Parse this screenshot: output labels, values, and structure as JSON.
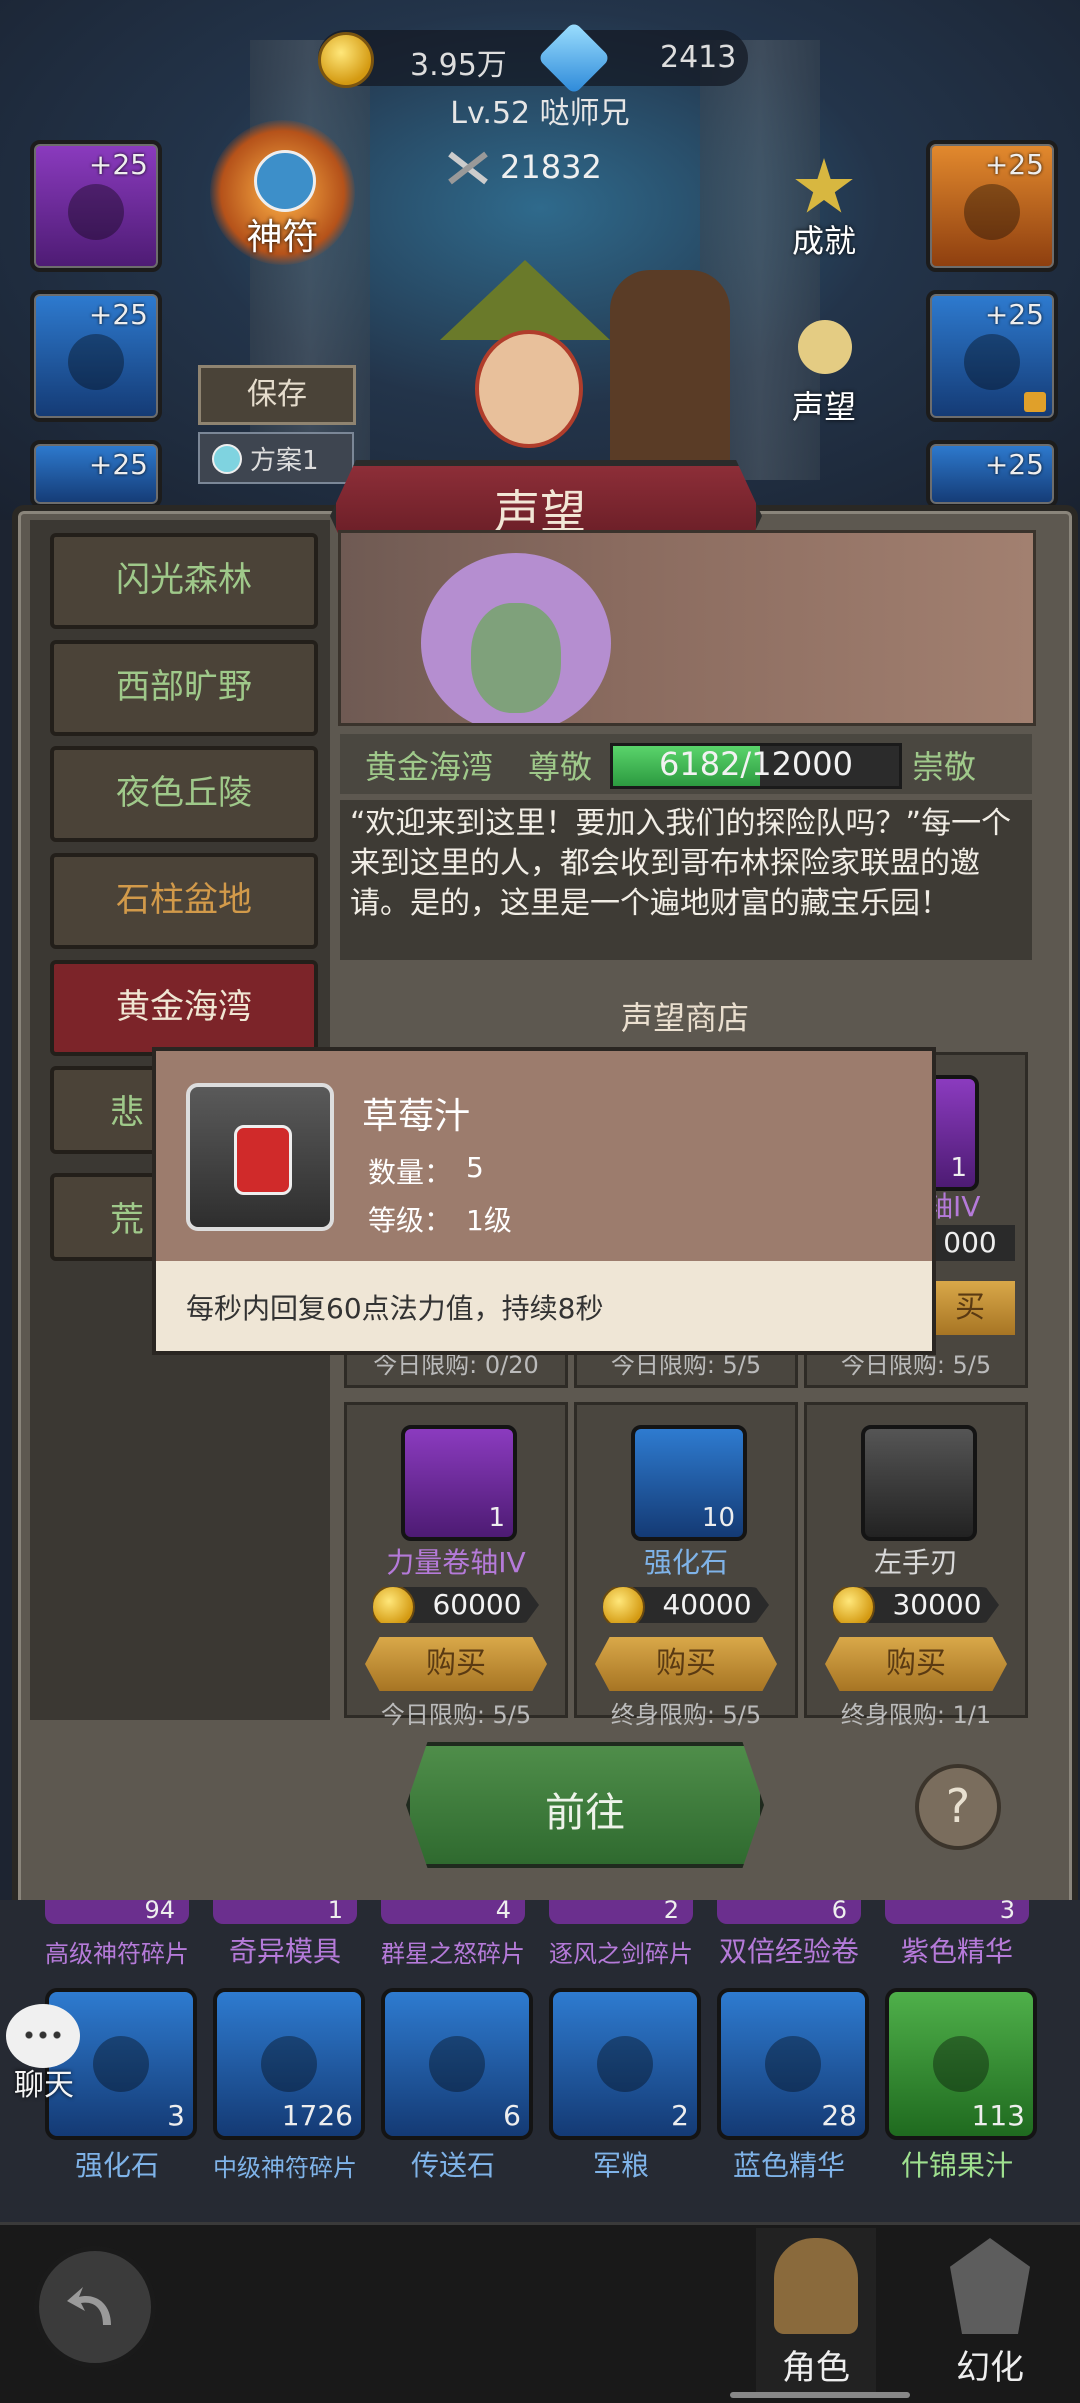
{
  "currency": {
    "gold": "3.95万",
    "gems": "2413"
  },
  "player": {
    "level_name": "Lv.52 哒师兄",
    "power": "21832"
  },
  "buttons": {
    "rune": "神符",
    "achievement": "成就",
    "reputation": "声望",
    "save": "保存",
    "plan1": "方案1"
  },
  "side_slots": {
    "plus": "+25"
  },
  "panel": {
    "title": "声望"
  },
  "regions": [
    "闪光森林",
    "西部旷野",
    "夜色丘陵",
    "石柱盆地",
    "黄金海湾",
    "悲",
    "荒"
  ],
  "faction": {
    "name": "黄金海湾",
    "current_rank": "尊敬",
    "progress_text": "6182/12000",
    "progress": 0.515,
    "next_rank": "崇敬",
    "description": "“欢迎来到这里！要加入我们的探险队吗？”每一个来到这里的人，都会收到哥布林探险家联盟的邀请。是的，这里是一个遍地财富的藏宝乐园！"
  },
  "shop": {
    "title": "声望商店",
    "top_row_partial": {
      "name_tail": "轴IV",
      "price_tail": "000",
      "count": "1",
      "buy_tail": "买"
    },
    "top_limits": [
      "今日限购: 0/20",
      "今日限购: 5/5",
      "今日限购: 5/5"
    ],
    "items": [
      {
        "name": "力量卷轴IV",
        "count": "1",
        "price": "60000",
        "buy": "购买",
        "limit": "今日限购: 5/5"
      },
      {
        "name": "强化石",
        "count": "10",
        "price": "40000",
        "buy": "购买",
        "limit": "终身限购: 5/5"
      },
      {
        "name": "左手刃",
        "count": "",
        "price": "30000",
        "buy": "购买",
        "limit": "终身限购: 1/1"
      }
    ]
  },
  "tooltip": {
    "name": "草莓汁",
    "qty_label": "数量：",
    "qty": "5",
    "level_label": "等级：",
    "level": "1级",
    "effect": "每秒内回复60点法力值，持续8秒"
  },
  "go_button": "前往",
  "help": "?",
  "inventory_top": [
    {
      "count": "94",
      "label": "高级神符碎片"
    },
    {
      "count": "1",
      "label": "奇异模具"
    },
    {
      "count": "4",
      "label": "群星之怒碎片"
    },
    {
      "count": "2",
      "label": "逐风之剑碎片"
    },
    {
      "count": "6",
      "label": "双倍经验卷"
    },
    {
      "count": "3",
      "label": "紫色精华"
    }
  ],
  "inventory": [
    {
      "count": "3",
      "label": "强化石"
    },
    {
      "count": "1726",
      "label": "中级神符碎片"
    },
    {
      "count": "6",
      "label": "传送石"
    },
    {
      "count": "2",
      "label": "军粮"
    },
    {
      "count": "28",
      "label": "蓝色精华"
    },
    {
      "count": "113",
      "label": "什锦果汁"
    }
  ],
  "chat": "聊天",
  "nav": {
    "character": "角色",
    "transform": "幻化"
  }
}
